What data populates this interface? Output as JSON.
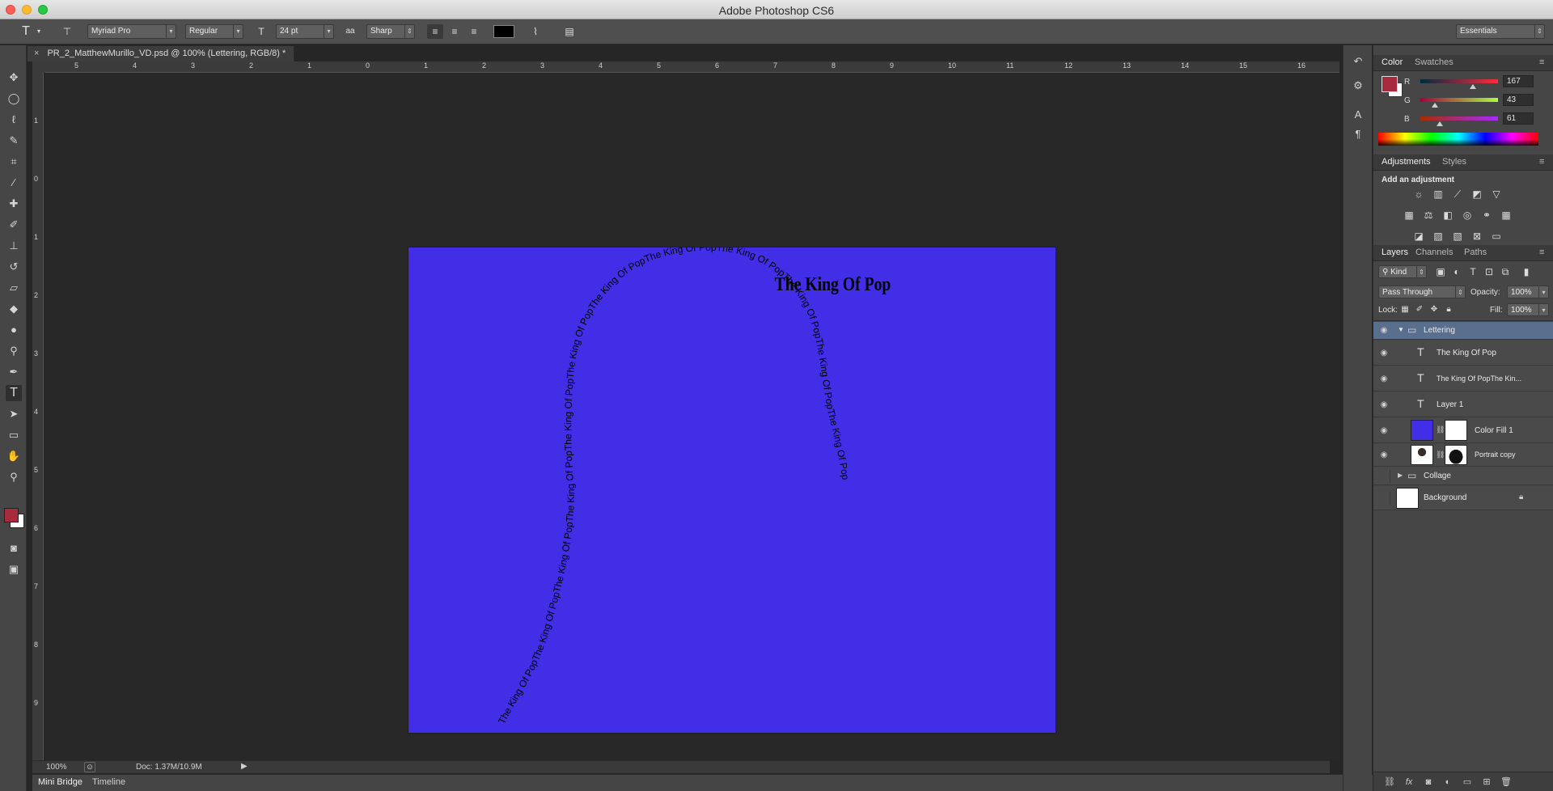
{
  "window": {
    "title": "Adobe Photoshop CS6"
  },
  "options_bar": {
    "font_family": "Myriad Pro",
    "font_style": "Regular",
    "font_size": "24 pt",
    "anti_alias_label": "aa",
    "anti_alias": "Sharp",
    "text_color": "#000000",
    "workspace": "Essentials"
  },
  "document": {
    "tab_title": "PR_2_MatthewMurillo_VD.psd @ 100% (Lettering, RGB/8) *",
    "zoom": "100%",
    "doc_size": "Doc: 1.37M/10.9M",
    "background_color": "#432ee8"
  },
  "canvas_text": {
    "heading": "The King Of Pop",
    "path_text": "The King Of PopThe King Of PopThe King Of PopThe King Of PopThe King Of PopThe King Of PopThe King Of PopThe King Of PopThe King Of PopThe King Of PopThe King Of PopThe King Of Pop"
  },
  "rulers": {
    "horizontal": [
      "5",
      "4",
      "3",
      "2",
      "1",
      "0",
      "1",
      "2",
      "3",
      "4",
      "5",
      "6",
      "7",
      "8",
      "9",
      "10",
      "11",
      "12",
      "13",
      "14",
      "15",
      "16"
    ],
    "vertical": [
      "1",
      "0",
      "1",
      "2",
      "3",
      "4",
      "5",
      "6",
      "7",
      "8",
      "9"
    ]
  },
  "bottom_tabs": [
    "Mini Bridge",
    "Timeline"
  ],
  "color_panel": {
    "tabs": [
      "Color",
      "Swatches"
    ],
    "foreground": "#a72b3d",
    "background": "#ffffff",
    "channels": [
      {
        "label": "R",
        "value": "167"
      },
      {
        "label": "G",
        "value": "43"
      },
      {
        "label": "B",
        "value": "61"
      }
    ]
  },
  "adjustments_panel": {
    "tabs": [
      "Adjustments",
      "Styles"
    ],
    "heading": "Add an adjustment"
  },
  "layers_panel": {
    "tabs": [
      "Layers",
      "Channels",
      "Paths"
    ],
    "filter_kind": "Kind",
    "blend_mode": "Pass Through",
    "opacity_label": "Opacity:",
    "opacity": "100%",
    "lock_label": "Lock:",
    "fill_label": "Fill:",
    "fill": "100%",
    "layers": [
      {
        "name": "Lettering",
        "kind": "group-open",
        "visible": true,
        "selected": true
      },
      {
        "name": "The King Of Pop",
        "kind": "text",
        "visible": true
      },
      {
        "name": "The King  Of PopThe Kin...",
        "kind": "text",
        "visible": true
      },
      {
        "name": "Layer 1",
        "kind": "text",
        "visible": true
      },
      {
        "name": "Color Fill 1",
        "kind": "fill",
        "visible": true,
        "color": "#432ee8"
      },
      {
        "name": "Portrait copy",
        "kind": "image",
        "visible": true
      },
      {
        "name": "Collage",
        "kind": "group-closed",
        "visible": false
      },
      {
        "name": "Background",
        "kind": "background",
        "visible": false
      }
    ]
  }
}
